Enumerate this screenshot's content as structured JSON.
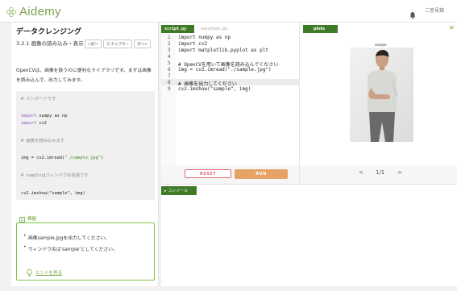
{
  "header": {
    "logo_text": "Aidemy",
    "user_label": "ご意見箱"
  },
  "lesson": {
    "section_title": "データクレンジング",
    "title": "3.2.1 画像の読み込み・表示",
    "nav": {
      "prev": "<前へ",
      "chapter": "☰ チャプター",
      "next": "次へ>"
    },
    "intro": "OpenCVは、画像を扱うのに便利なライブラリです。まずは画像を読み込んで、出力してみます。",
    "code_lines": [
      {
        "type": "comment",
        "text": "# インポートです"
      },
      {
        "type": "code",
        "kw": "import",
        "rest": " numpy as np"
      },
      {
        "type": "code",
        "kw": "import",
        "rest": " cv2"
      },
      {
        "type": "comment",
        "text": "# 画像を読み込みます"
      },
      {
        "type": "code_str",
        "pre": "img = cv2.imread(",
        "str": "\"./sample.jpg\"",
        "post": ")"
      },
      {
        "type": "comment",
        "text": "# sampleはウィンドウの名前です"
      },
      {
        "type": "code_plain",
        "text": "cv2.imshow(\"sample\", img)"
      }
    ],
    "task_label": "課題",
    "tasks": [
      "画像sample.jpgを出力してください。",
      "ウィンドウ名は'sample'としてください。"
    ],
    "hint_label": "ヒントを見る"
  },
  "editor": {
    "tabs": [
      "script.py",
      "solution.py"
    ],
    "lines": [
      "import numpy as np",
      "import cv2",
      "import matplotlib.pyplot as plt",
      "",
      "# OpenCVを用いて画像を読み込んでください",
      "img = cv2.imread(\"./sample.jpg\")",
      "",
      "# 画像を出力してください",
      "cv2.imshow(\"sample\", img)"
    ],
    "reset_label": "RESET",
    "run_label": "RUN"
  },
  "plots": {
    "tab_label": "plots",
    "close_symbol": "✕",
    "image_title": "sample",
    "prev": "<",
    "page": "1/1",
    "next": ">"
  },
  "console": {
    "tab_label": "▸ コンソール"
  },
  "colors": {
    "accent_green": "#3f7a27",
    "run_orange": "#e7a365",
    "reset_red": "#e06a7a",
    "brand_green": "#7aa24a"
  }
}
